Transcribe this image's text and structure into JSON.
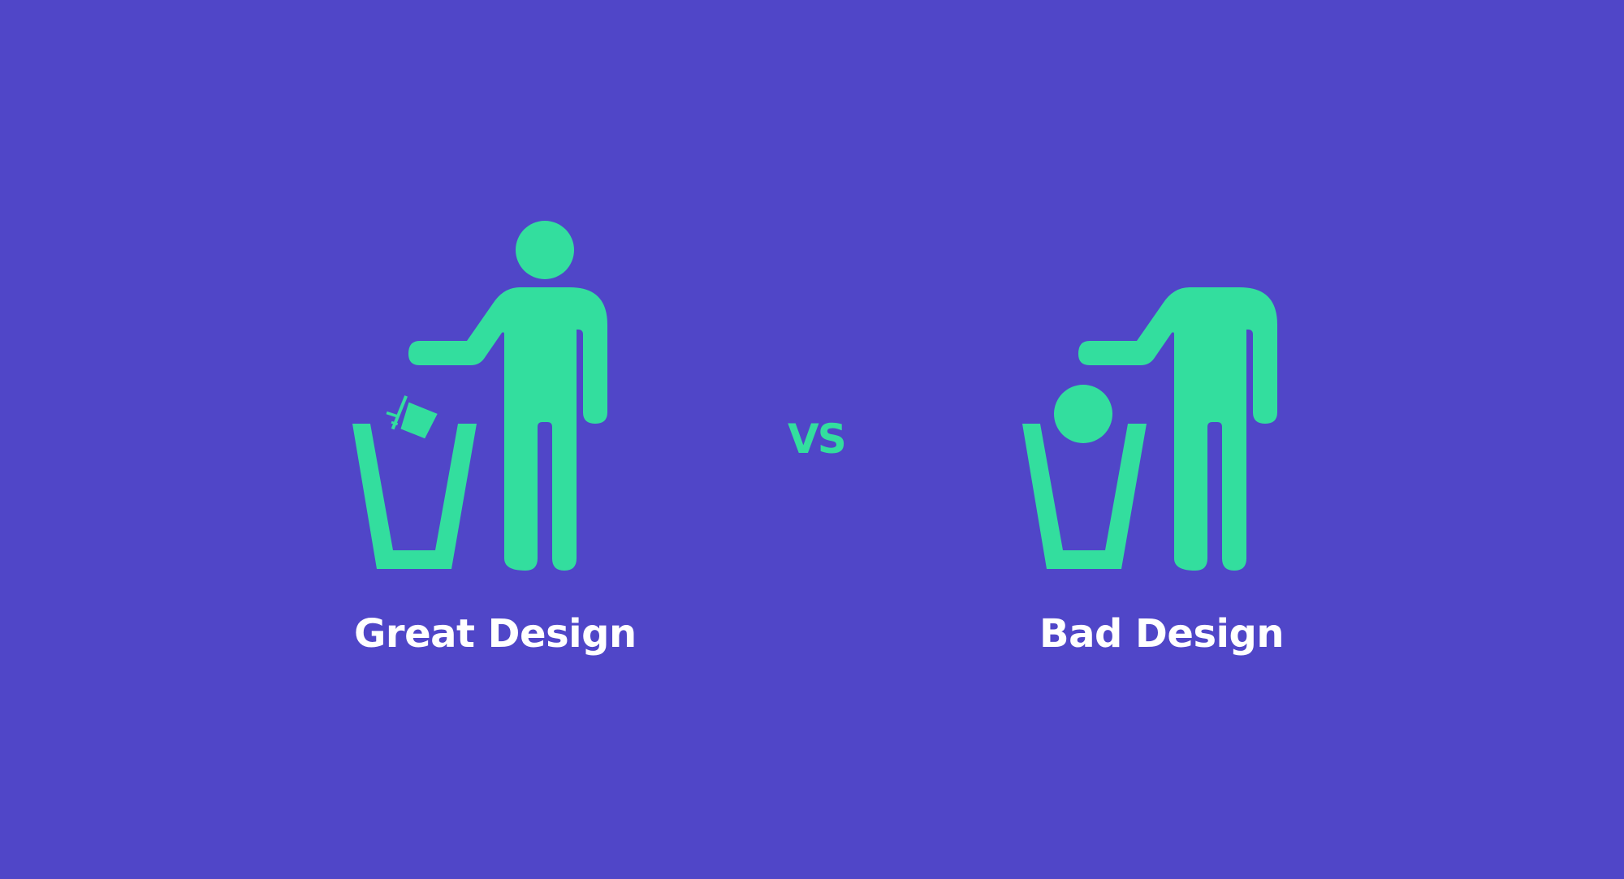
{
  "colors": {
    "background": "#5046C8",
    "figure": "#33DE9E",
    "text": "#FFFFFF"
  },
  "left_panel": {
    "label": "Great Design",
    "icon": "person-tossing-cup-into-bin-icon"
  },
  "divider": {
    "label": "VS"
  },
  "right_panel": {
    "label": "Bad Design",
    "icon": "person-tossing-own-head-into-bin-icon"
  }
}
